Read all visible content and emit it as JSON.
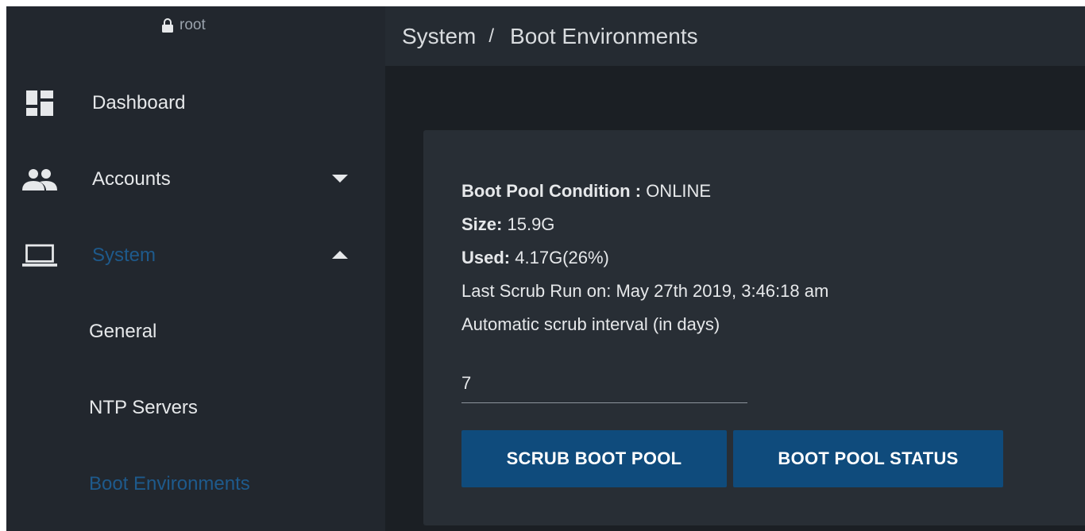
{
  "user": {
    "name": "root",
    "icon": "lock-icon"
  },
  "breadcrumb": {
    "parent": "System",
    "separator": "/",
    "current": "Boot Environments"
  },
  "sidebar": {
    "items": [
      {
        "label": "Dashboard",
        "icon": "dashboard-icon"
      },
      {
        "label": "Accounts",
        "icon": "people-icon",
        "caret": "caret-down-icon"
      },
      {
        "label": "System",
        "icon": "laptop-icon",
        "caret": "caret-up-icon",
        "active": true
      }
    ],
    "sub_items": [
      {
        "label": "General"
      },
      {
        "label": "NTP Servers"
      },
      {
        "label": "Boot Environments",
        "active": true
      }
    ]
  },
  "pool": {
    "condition_label": "Boot Pool Condition :",
    "condition_value": "ONLINE",
    "size_label": "Size:",
    "size_value": "15.9G",
    "used_label": "Used:",
    "used_value": "4.17G(26%)",
    "last_scrub": "Last Scrub Run on: May 27th 2019, 3:46:18 am",
    "interval_label": "Automatic scrub interval (in days)",
    "interval_value": "7"
  },
  "buttons": {
    "scrub": "SCRUB BOOT POOL",
    "status": "BOOT POOL STATUS"
  },
  "colors": {
    "accent": "#1e5a8c",
    "button": "#0f4b7c",
    "sidebar_bg": "#22272e",
    "card_bg": "#282e35"
  }
}
